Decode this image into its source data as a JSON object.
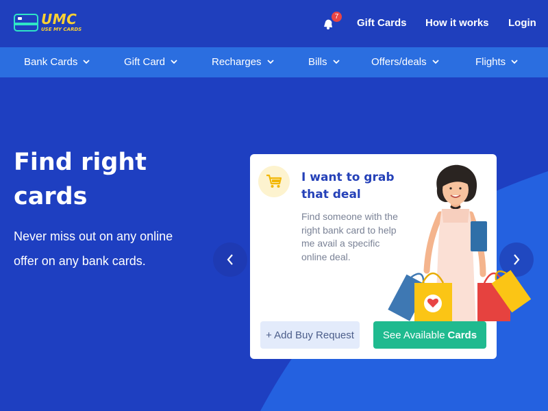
{
  "header": {
    "logo_text": "UMC",
    "logo_subtext": "USE MY CARDS",
    "notification_count": "7",
    "links": [
      "Gift Cards",
      "How it works",
      "Login"
    ]
  },
  "nav": {
    "items": [
      "Bank Cards",
      "Gift Card",
      "Recharges",
      "Bills",
      "Offers/deals",
      "Flights"
    ]
  },
  "hero": {
    "title_line1": "Find right",
    "title_line2": "cards",
    "subtitle": "Never miss out on any online offer on any bank cards."
  },
  "card": {
    "title": "I want to grab that deal",
    "description": "Find someone with the right bank card to help me avail a specific online deal.",
    "add_button": "+ Add Buy Request",
    "see_button_prefix": "See Available",
    "see_button_bold": "Cards"
  },
  "colors": {
    "background": "#1e3fc1",
    "navbar": "#2b6ee0",
    "accent_yellow": "#fcd133",
    "card_title": "#2541b8",
    "green_button": "#1fba8f",
    "badge_red": "#e84545"
  },
  "icons": {
    "bell": "bell-icon",
    "cart": "cart-icon",
    "chevron": "chevron-down-icon",
    "prev": "chevron-left-icon",
    "next": "chevron-right-icon"
  }
}
